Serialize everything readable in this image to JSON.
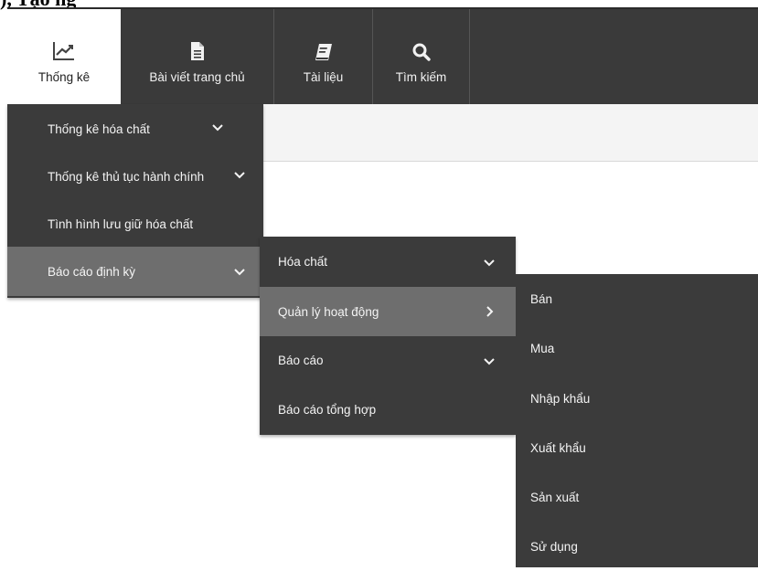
{
  "heading": {
    "text": "), Tạo ng"
  },
  "nav": {
    "tabs": [
      {
        "label": "Thống kê",
        "icon": "line-chart-icon",
        "active": true
      },
      {
        "label": "Bài viết trang chủ",
        "icon": "document-icon",
        "active": false
      },
      {
        "label": "Tài liệu",
        "icon": "book-icon",
        "active": false
      },
      {
        "label": "Tìm kiếm",
        "icon": "search-icon",
        "active": false
      }
    ]
  },
  "menu1": {
    "items": [
      {
        "label": "Thống kê hóa chất",
        "chevron": "down"
      },
      {
        "label": "Thống kê thủ tục hành chính",
        "chevron": "down"
      },
      {
        "label": "Tình hình lưu giữ hóa chất",
        "chevron": ""
      },
      {
        "label": "Báo cáo định kỳ",
        "chevron": "down"
      }
    ]
  },
  "menu2": {
    "items": [
      {
        "label": "Hóa chất",
        "chevron": "down"
      },
      {
        "label": "Quản lý hoạt động",
        "chevron": "right"
      },
      {
        "label": "Báo cáo",
        "chevron": "down"
      },
      {
        "label": "Báo cáo tổng hợp",
        "chevron": ""
      }
    ]
  },
  "menu3": {
    "items": [
      {
        "label": "Bán"
      },
      {
        "label": "Mua"
      },
      {
        "label": "Nhập khẩu"
      },
      {
        "label": "Xuất khẩu"
      },
      {
        "label": "Sản xuất"
      },
      {
        "label": "Sử dụng"
      }
    ]
  },
  "colors": {
    "bar": "#3a3a3a",
    "menu": "#3b3b3b",
    "active_item": "#6e6e6e",
    "active_tab": "#ffffff"
  }
}
